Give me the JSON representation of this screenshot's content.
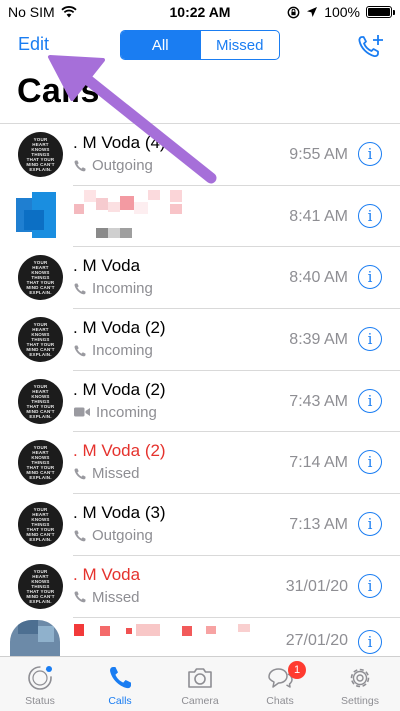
{
  "status_bar": {
    "carrier": "No SIM",
    "time": "10:22 AM",
    "battery": "100%",
    "battery_level": 1.0
  },
  "nav": {
    "edit_label": "Edit",
    "segments": [
      "All",
      "Missed"
    ],
    "selected_segment": "All"
  },
  "page": {
    "title": "Calls"
  },
  "avatar_text": "YOUR HEART KNOWS THINGS THAT YOUR MIND CAN'T EXPLAIN.",
  "calls": [
    {
      "name": ". M Voda  (4)",
      "type": "Outgoing",
      "icon": "phone-icon",
      "time": "9:55 AM",
      "missed": false
    },
    {
      "name": "",
      "type": "",
      "icon": "",
      "time": "8:41 AM",
      "missed": false
    },
    {
      "name": ". M Voda",
      "type": "Incoming",
      "icon": "phone-icon",
      "time": "8:40 AM",
      "missed": false
    },
    {
      "name": ". M Voda  (2)",
      "type": "Incoming",
      "icon": "phone-icon",
      "time": "8:39 AM",
      "missed": false
    },
    {
      "name": ". M Voda  (2)",
      "type": "Incoming",
      "icon": "video-icon",
      "time": "7:43 AM",
      "missed": false
    },
    {
      "name": ". M Voda  (2)",
      "type": "Missed",
      "icon": "phone-icon",
      "time": "7:14 AM",
      "missed": true
    },
    {
      "name": ". M Voda  (3)",
      "type": "Outgoing",
      "icon": "phone-icon",
      "time": "7:13 AM",
      "missed": false
    },
    {
      "name": ". M Voda",
      "type": "Missed",
      "icon": "phone-icon",
      "time": "31/01/20",
      "missed": true
    },
    {
      "name": "",
      "type": "",
      "icon": "",
      "time": "27/01/20",
      "missed": false
    }
  ],
  "tabs": [
    {
      "label": "Status",
      "icon": "status-icon",
      "active": false
    },
    {
      "label": "Calls",
      "icon": "phone-icon",
      "active": true
    },
    {
      "label": "Camera",
      "icon": "camera-icon",
      "active": false
    },
    {
      "label": "Chats",
      "icon": "chat-bubbles-icon",
      "active": false,
      "badge": "1"
    },
    {
      "label": "Settings",
      "icon": "gear-icon",
      "active": false
    }
  ],
  "colors": {
    "accent": "#1a7df2",
    "missed": "#e5322d",
    "secondary_text": "#8e8e93",
    "annotation_arrow": "#a66fd9",
    "badge": "#ff3b30"
  }
}
